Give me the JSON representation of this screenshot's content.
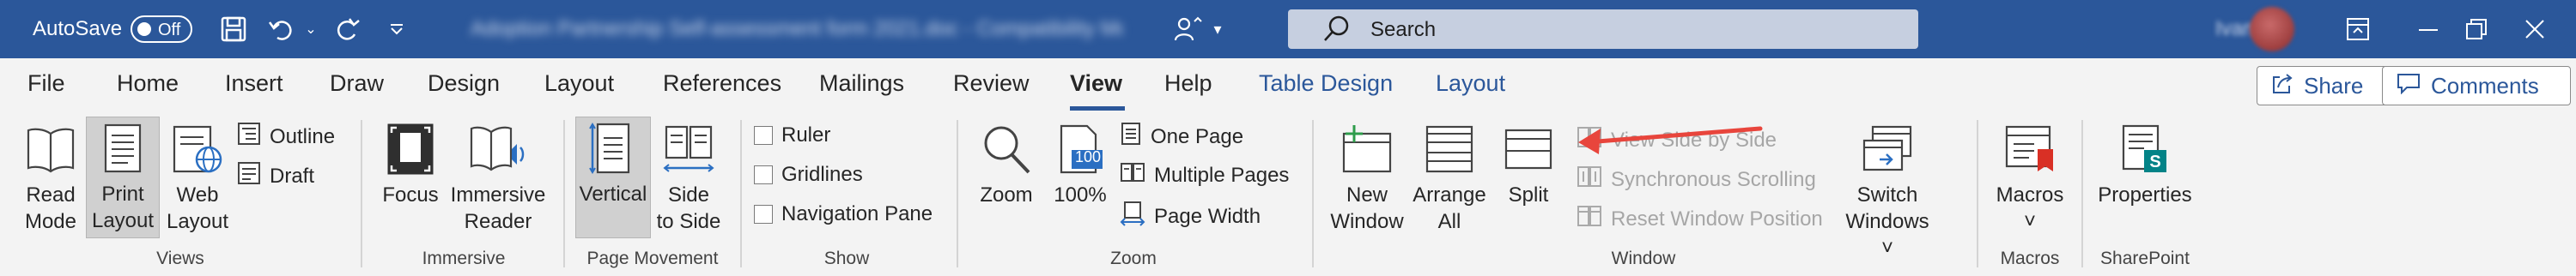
{
  "titlebar": {
    "autosave_label": "AutoSave",
    "autosave_state": "Off",
    "doc_title": "Adoption Partnership Self-assessment form 2021.doc - Compatibility Mode",
    "search_placeholder": "Search",
    "user_name": "Ivan G",
    "quick_access": [
      "save-icon",
      "undo-icon",
      "redo-icon",
      "customize-qat-icon"
    ]
  },
  "tabs": {
    "file": "File",
    "home": "Home",
    "insert": "Insert",
    "draw": "Draw",
    "design": "Design",
    "layout": "Layout",
    "references": "References",
    "mailings": "Mailings",
    "review": "Review",
    "view": "View",
    "help": "Help",
    "table_design": "Table Design",
    "table_layout": "Layout"
  },
  "actions": {
    "share": "Share",
    "comments": "Comments"
  },
  "ribbon": {
    "views": {
      "label": "Views",
      "read_mode": [
        "Read",
        "Mode"
      ],
      "print_layout": [
        "Print",
        "Layout"
      ],
      "web_layout": [
        "Web",
        "Layout"
      ],
      "outline": "Outline",
      "draft": "Draft"
    },
    "immersive": {
      "label": "Immersive",
      "focus": [
        "Focus"
      ],
      "immersive_reader": [
        "Immersive",
        "Reader"
      ]
    },
    "page_movement": {
      "label": "Page Movement",
      "vertical": [
        "Vertical"
      ],
      "side_to_side": [
        "Side",
        "to Side"
      ]
    },
    "show": {
      "label": "Show",
      "ruler": "Ruler",
      "gridlines": "Gridlines",
      "navigation_pane": "Navigation Pane"
    },
    "zoom": {
      "label": "Zoom",
      "zoom": [
        "Zoom"
      ],
      "hundred": [
        "100%"
      ],
      "hundred_icon_text": "100",
      "one_page": "One Page",
      "multiple_pages": "Multiple Pages",
      "page_width": "Page Width"
    },
    "window": {
      "label": "Window",
      "new_window": [
        "New",
        "Window"
      ],
      "arrange_all": [
        "Arrange",
        "All"
      ],
      "split": [
        "Split"
      ],
      "view_side_by_side": "View Side by Side",
      "synchronous_scrolling": "Synchronous Scrolling",
      "reset_window_position": "Reset Window Position",
      "switch_windows": [
        "Switch",
        "Windows ˅"
      ]
    },
    "macros": {
      "label": "Macros",
      "macros": [
        "Macros",
        "˅"
      ]
    },
    "sharepoint": {
      "label": "SharePoint",
      "properties": [
        "Properties"
      ]
    }
  },
  "colors": {
    "accent": "#2b579a",
    "annotation_arrow": "#e8453c",
    "sharepoint_green": "#038387"
  }
}
